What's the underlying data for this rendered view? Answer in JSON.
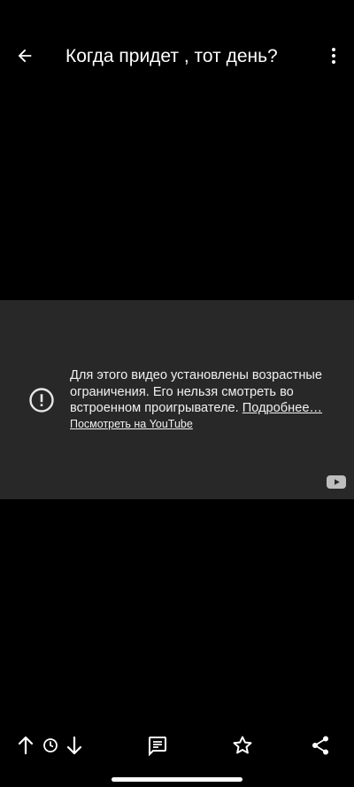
{
  "header": {
    "title": "Когда придет , тот день?",
    "back_icon": "arrow-back-icon",
    "more_icon": "more-vertical-icon"
  },
  "player": {
    "message": "Для этого видео установлены возрастные ограничения. Его нельзя смотреть во встроенном проигрывателе.",
    "more_link": "Подробнее…",
    "watch_link": "Посмотреть на YouTube",
    "background_color": "#282828"
  },
  "bottom_bar": {
    "icons": [
      "arrow-up-icon",
      "clock-icon",
      "arrow-down-icon",
      "comment-icon",
      "star-icon",
      "share-icon"
    ]
  }
}
